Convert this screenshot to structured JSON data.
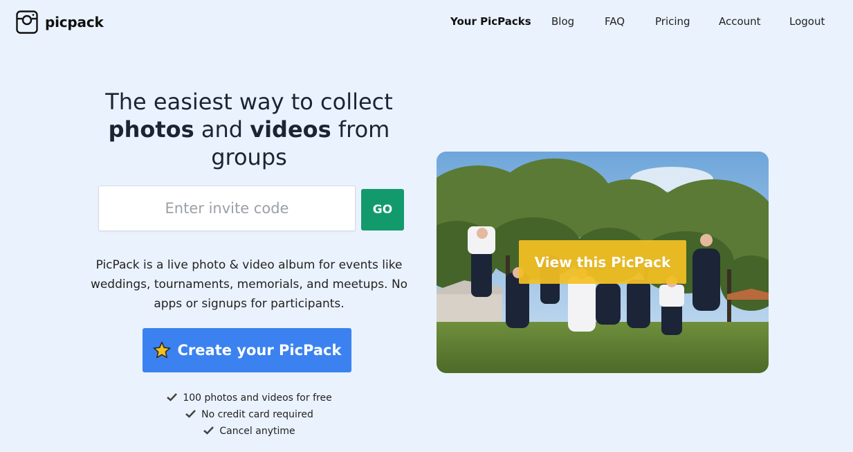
{
  "app": {
    "name": "picpack",
    "logo_icon": "camera-icon"
  },
  "nav": {
    "items": [
      {
        "label": "Your PicPacks",
        "active": true
      },
      {
        "label": "Blog",
        "active": false
      },
      {
        "label": "FAQ",
        "active": false
      },
      {
        "label": "Pricing",
        "active": false
      },
      {
        "label": "Account",
        "active": false
      },
      {
        "label": "Logout",
        "active": false
      }
    ]
  },
  "hero": {
    "title_line1": "The easiest way to collect",
    "title_bold1": "photos",
    "title_and": " and ",
    "title_bold2": "videos",
    "title_from": " from",
    "title_line3": "groups"
  },
  "invite": {
    "placeholder": "Enter invite code",
    "value": "",
    "go_label": "GO"
  },
  "description": "PicPack is a live photo & video album for events like weddings, tournaments, memorials, and meetups. No apps or signups for participants.",
  "cta": {
    "label": "Create your PicPack",
    "icon": "star-icon"
  },
  "features": [
    "100 photos and videos for free",
    "No credit card required",
    "Cancel anytime"
  ],
  "photo_card": {
    "view_label": "View this PicPack"
  },
  "colors": {
    "background": "#eaf2fd",
    "go_button": "#139a6c",
    "cta_button": "#3b82f0",
    "view_button": "#f3bf22",
    "star": "#f6c21a"
  }
}
